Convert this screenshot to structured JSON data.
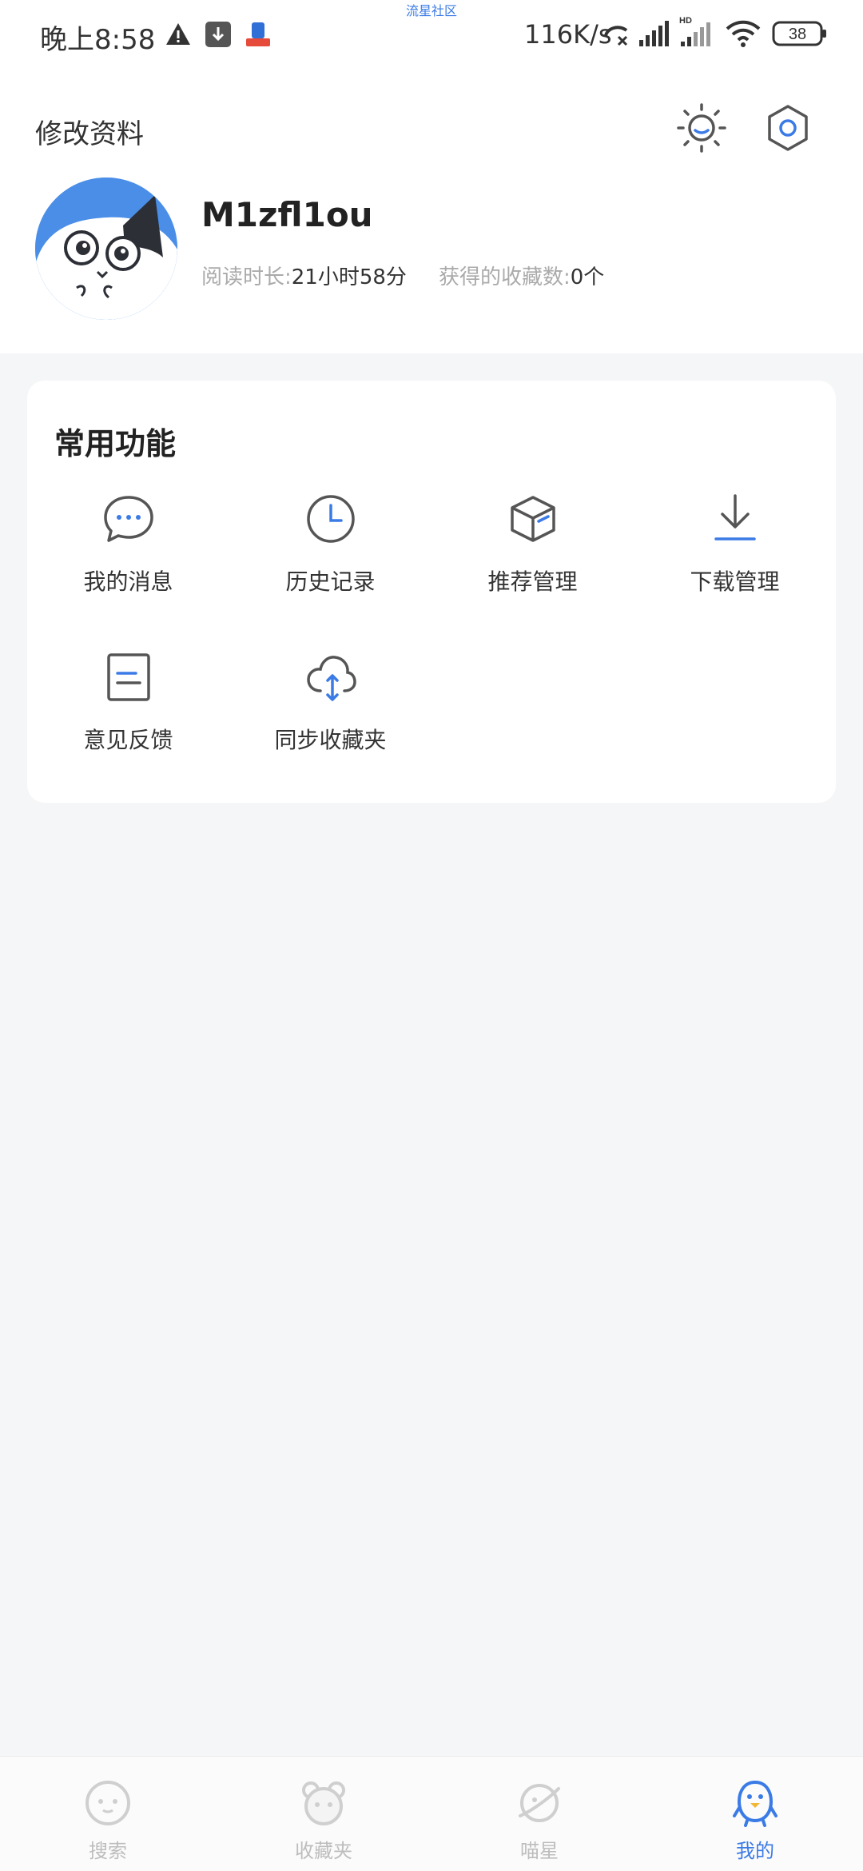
{
  "status_bar": {
    "time": "晚上8:58",
    "top_label": "流星社区",
    "network_speed": "116K/s",
    "battery": "38",
    "hd_label": "HD"
  },
  "header": {
    "title": "修改资料"
  },
  "profile": {
    "username": "M1zfl1ou",
    "reading_time_label": "阅读时长:",
    "reading_time_value": "21小时58分",
    "favorites_label": "获得的收藏数:",
    "favorites_value": "0个"
  },
  "functions": {
    "title": "常用功能",
    "items": [
      {
        "label": "我的消息",
        "icon": "chat-bubble-icon"
      },
      {
        "label": "历史记录",
        "icon": "clock-icon"
      },
      {
        "label": "推荐管理",
        "icon": "cube-icon"
      },
      {
        "label": "下载管理",
        "icon": "download-icon"
      },
      {
        "label": "意见反馈",
        "icon": "document-icon"
      },
      {
        "label": "同步收藏夹",
        "icon": "cloud-sync-icon"
      }
    ]
  },
  "tabbar": {
    "tabs": [
      {
        "label": "搜索",
        "icon": "search-face-icon"
      },
      {
        "label": "收藏夹",
        "icon": "bear-icon"
      },
      {
        "label": "喵星",
        "icon": "planet-icon"
      },
      {
        "label": "我的",
        "icon": "penguin-icon"
      }
    ],
    "active_index": 3
  },
  "colors": {
    "accent": "#3b7be6",
    "page_background": "#f5f6f8",
    "card_background": "#ffffff",
    "tab_inactive": "#bdbdbd"
  }
}
